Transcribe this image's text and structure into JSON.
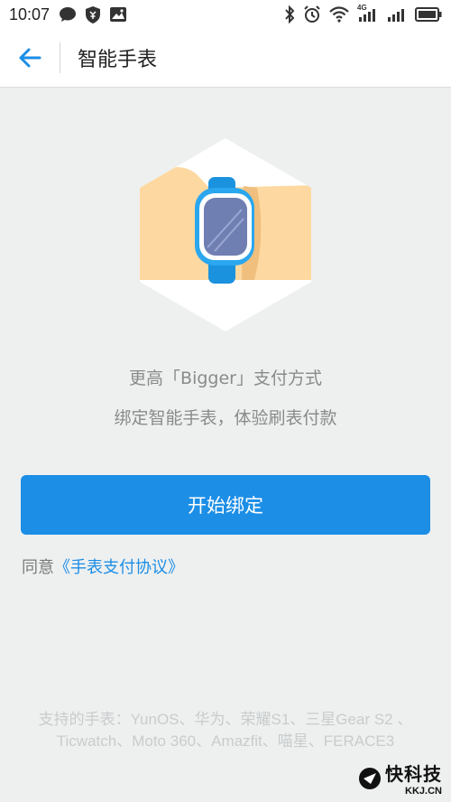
{
  "status_bar": {
    "time": "10:07",
    "network": "4G",
    "left_icons": [
      "chat-bubble-icon",
      "shield-icon",
      "image-notification-icon"
    ],
    "right_icons": [
      "bluetooth-icon",
      "alarm-icon",
      "wifi-icon",
      "signal-icon",
      "signal-icon",
      "battery-icon"
    ]
  },
  "app_bar": {
    "back_icon": "arrow-left-icon",
    "title": "智能手表"
  },
  "hero": {
    "icon": "smartwatch-illustration",
    "colors": {
      "hexagon": "#ffffff",
      "band": "#fdd9a1",
      "watch": "#2aa7ee",
      "screen": "#6f7fb2"
    }
  },
  "content": {
    "headline": "更高「Bigger」支付方式",
    "subline": "绑定智能手表，体验刷表付款"
  },
  "bind_button": {
    "label": "开始绑定"
  },
  "agreement": {
    "prefix": "同意",
    "link": "《手表支付协议》"
  },
  "support_text": "支持的手表：YunOS、华为、荣耀S1、三星Gear S2 、Ticwatch、Moto 360、Amazfit、喵星、FERACE3",
  "watermark": {
    "cn": "快科技",
    "en": "KKJ.CN"
  },
  "colors": {
    "accent": "#1c8ee6",
    "background": "#eef0f0",
    "muted_text": "#8a8a8a"
  }
}
